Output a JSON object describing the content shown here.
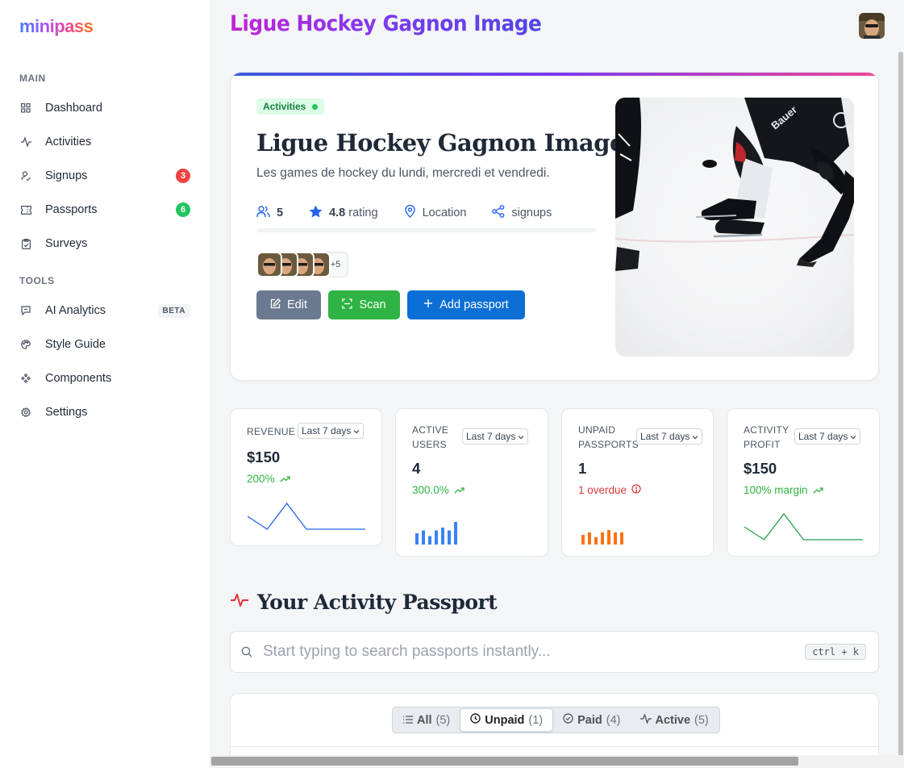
{
  "app": {
    "logo": "minipass",
    "title": "Ligue Hockey Gagnon Image"
  },
  "sidebar": {
    "sections": [
      {
        "label": "MAIN",
        "items": [
          {
            "label": "Dashboard",
            "icon": "grid-icon"
          },
          {
            "label": "Activities",
            "icon": "activity-icon"
          },
          {
            "label": "Signups",
            "icon": "signup-icon",
            "badge": "3",
            "badge_color": "#ef4444"
          },
          {
            "label": "Passports",
            "icon": "ticket-icon",
            "badge": "6",
            "badge_color": "#22c55e"
          },
          {
            "label": "Surveys",
            "icon": "clipboard-icon"
          }
        ]
      },
      {
        "label": "TOOLS",
        "items": [
          {
            "label": "AI Analytics",
            "icon": "chat-icon",
            "pill": "BETA"
          },
          {
            "label": "Style Guide",
            "icon": "palette-icon"
          },
          {
            "label": "Components",
            "icon": "components-icon"
          },
          {
            "label": "Settings",
            "icon": "gear-icon"
          }
        ]
      }
    ]
  },
  "hero": {
    "badge": "Activities",
    "title": "Ligue Hockey Gagnon Image",
    "description": "Les games de hockey du lundi, mercredi et vendredi.",
    "stats": {
      "users": "5",
      "rating_value": "4.8",
      "rating_label": "rating",
      "location": "Location",
      "signups": "signups"
    },
    "avatars_more": "+5",
    "buttons": {
      "edit": "Edit",
      "scan": "Scan",
      "add": "Add passport"
    },
    "colors": {
      "edit": "#6b7a90",
      "scan": "#2fb344",
      "add": "#0b6fd6"
    }
  },
  "kpis": [
    {
      "label": [
        "REVENUE"
      ],
      "period": "Last 7 days",
      "value": "$150",
      "trend": "200%",
      "trend_color": "#2fb344",
      "trend_icon": "trend-up-icon",
      "spark": {
        "type": "line",
        "color": "#2563eb",
        "values": [
          3,
          1,
          5,
          1,
          1,
          1,
          1
        ]
      }
    },
    {
      "label": [
        "ACTIVE",
        "USERS"
      ],
      "period": "Last 7 days",
      "value": "4",
      "trend": "300.0%",
      "trend_color": "#2fb344",
      "trend_icon": "trend-up-icon",
      "spark": {
        "type": "bar",
        "color": "#3b82f6",
        "values": [
          4,
          5,
          3,
          5,
          6,
          5,
          8
        ]
      }
    },
    {
      "label": [
        "UNPAID",
        "PASSPORTS"
      ],
      "period": "Last 7 days",
      "value": "1",
      "trend": "1 overdue",
      "trend_color": "#d63939",
      "trend_icon": "alert-icon",
      "spark": {
        "type": "bar",
        "color": "#f97316",
        "values": [
          4,
          5,
          3,
          5,
          6,
          5,
          5
        ]
      }
    },
    {
      "label": [
        "ACTIVITY",
        "PROFIT"
      ],
      "period": "Last 7 days",
      "value": "$150",
      "trend": "100% margin",
      "trend_color": "#2fb344",
      "trend_icon": "trend-up-icon",
      "spark": {
        "type": "line",
        "color": "#22a34a",
        "values": [
          3,
          1,
          5,
          1,
          1,
          1,
          1
        ]
      }
    }
  ],
  "passport_section": {
    "title": "Your Activity Passport",
    "search_placeholder": "Start typing to search passports instantly...",
    "shortcut": "ctrl + k",
    "filters": [
      {
        "label": "All",
        "count": "(5)",
        "icon": "list-icon"
      },
      {
        "label": "Unpaid",
        "count": "(1)",
        "icon": "clock-icon",
        "active": true
      },
      {
        "label": "Paid",
        "count": "(4)",
        "icon": "check-circle-icon"
      },
      {
        "label": "Active",
        "count": "(5)",
        "icon": "activity-icon"
      }
    ]
  }
}
